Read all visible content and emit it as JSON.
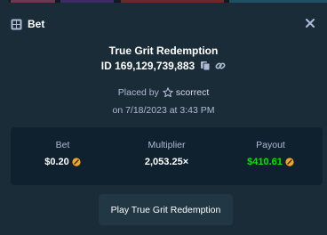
{
  "header": {
    "title": "Bet"
  },
  "bet": {
    "game_title": "True Grit Redemption",
    "id_text": "ID 169,129,739,883",
    "placed_by_label": "Placed by",
    "username": "scorrect",
    "datetime": "on 7/18/2023 at 3:43 PM"
  },
  "stats": {
    "bet_label": "Bet",
    "bet_value": "$0.20",
    "multiplier_label": "Multiplier",
    "multiplier_value": "2,053.25×",
    "payout_label": "Payout",
    "payout_value": "$410.61"
  },
  "play_button": {
    "label": "Play True Grit Redemption"
  },
  "icons": {
    "header": "bet-slip-icon",
    "close": "close-icon",
    "copy": "copy-icon",
    "link": "link-icon",
    "user_rank": "star-icon",
    "currency": "coin-icon"
  },
  "colors": {
    "background": "#1a2c38",
    "panel": "#0f212e",
    "button": "#213743",
    "payout": "#00e701",
    "coin": "#f5a623"
  }
}
